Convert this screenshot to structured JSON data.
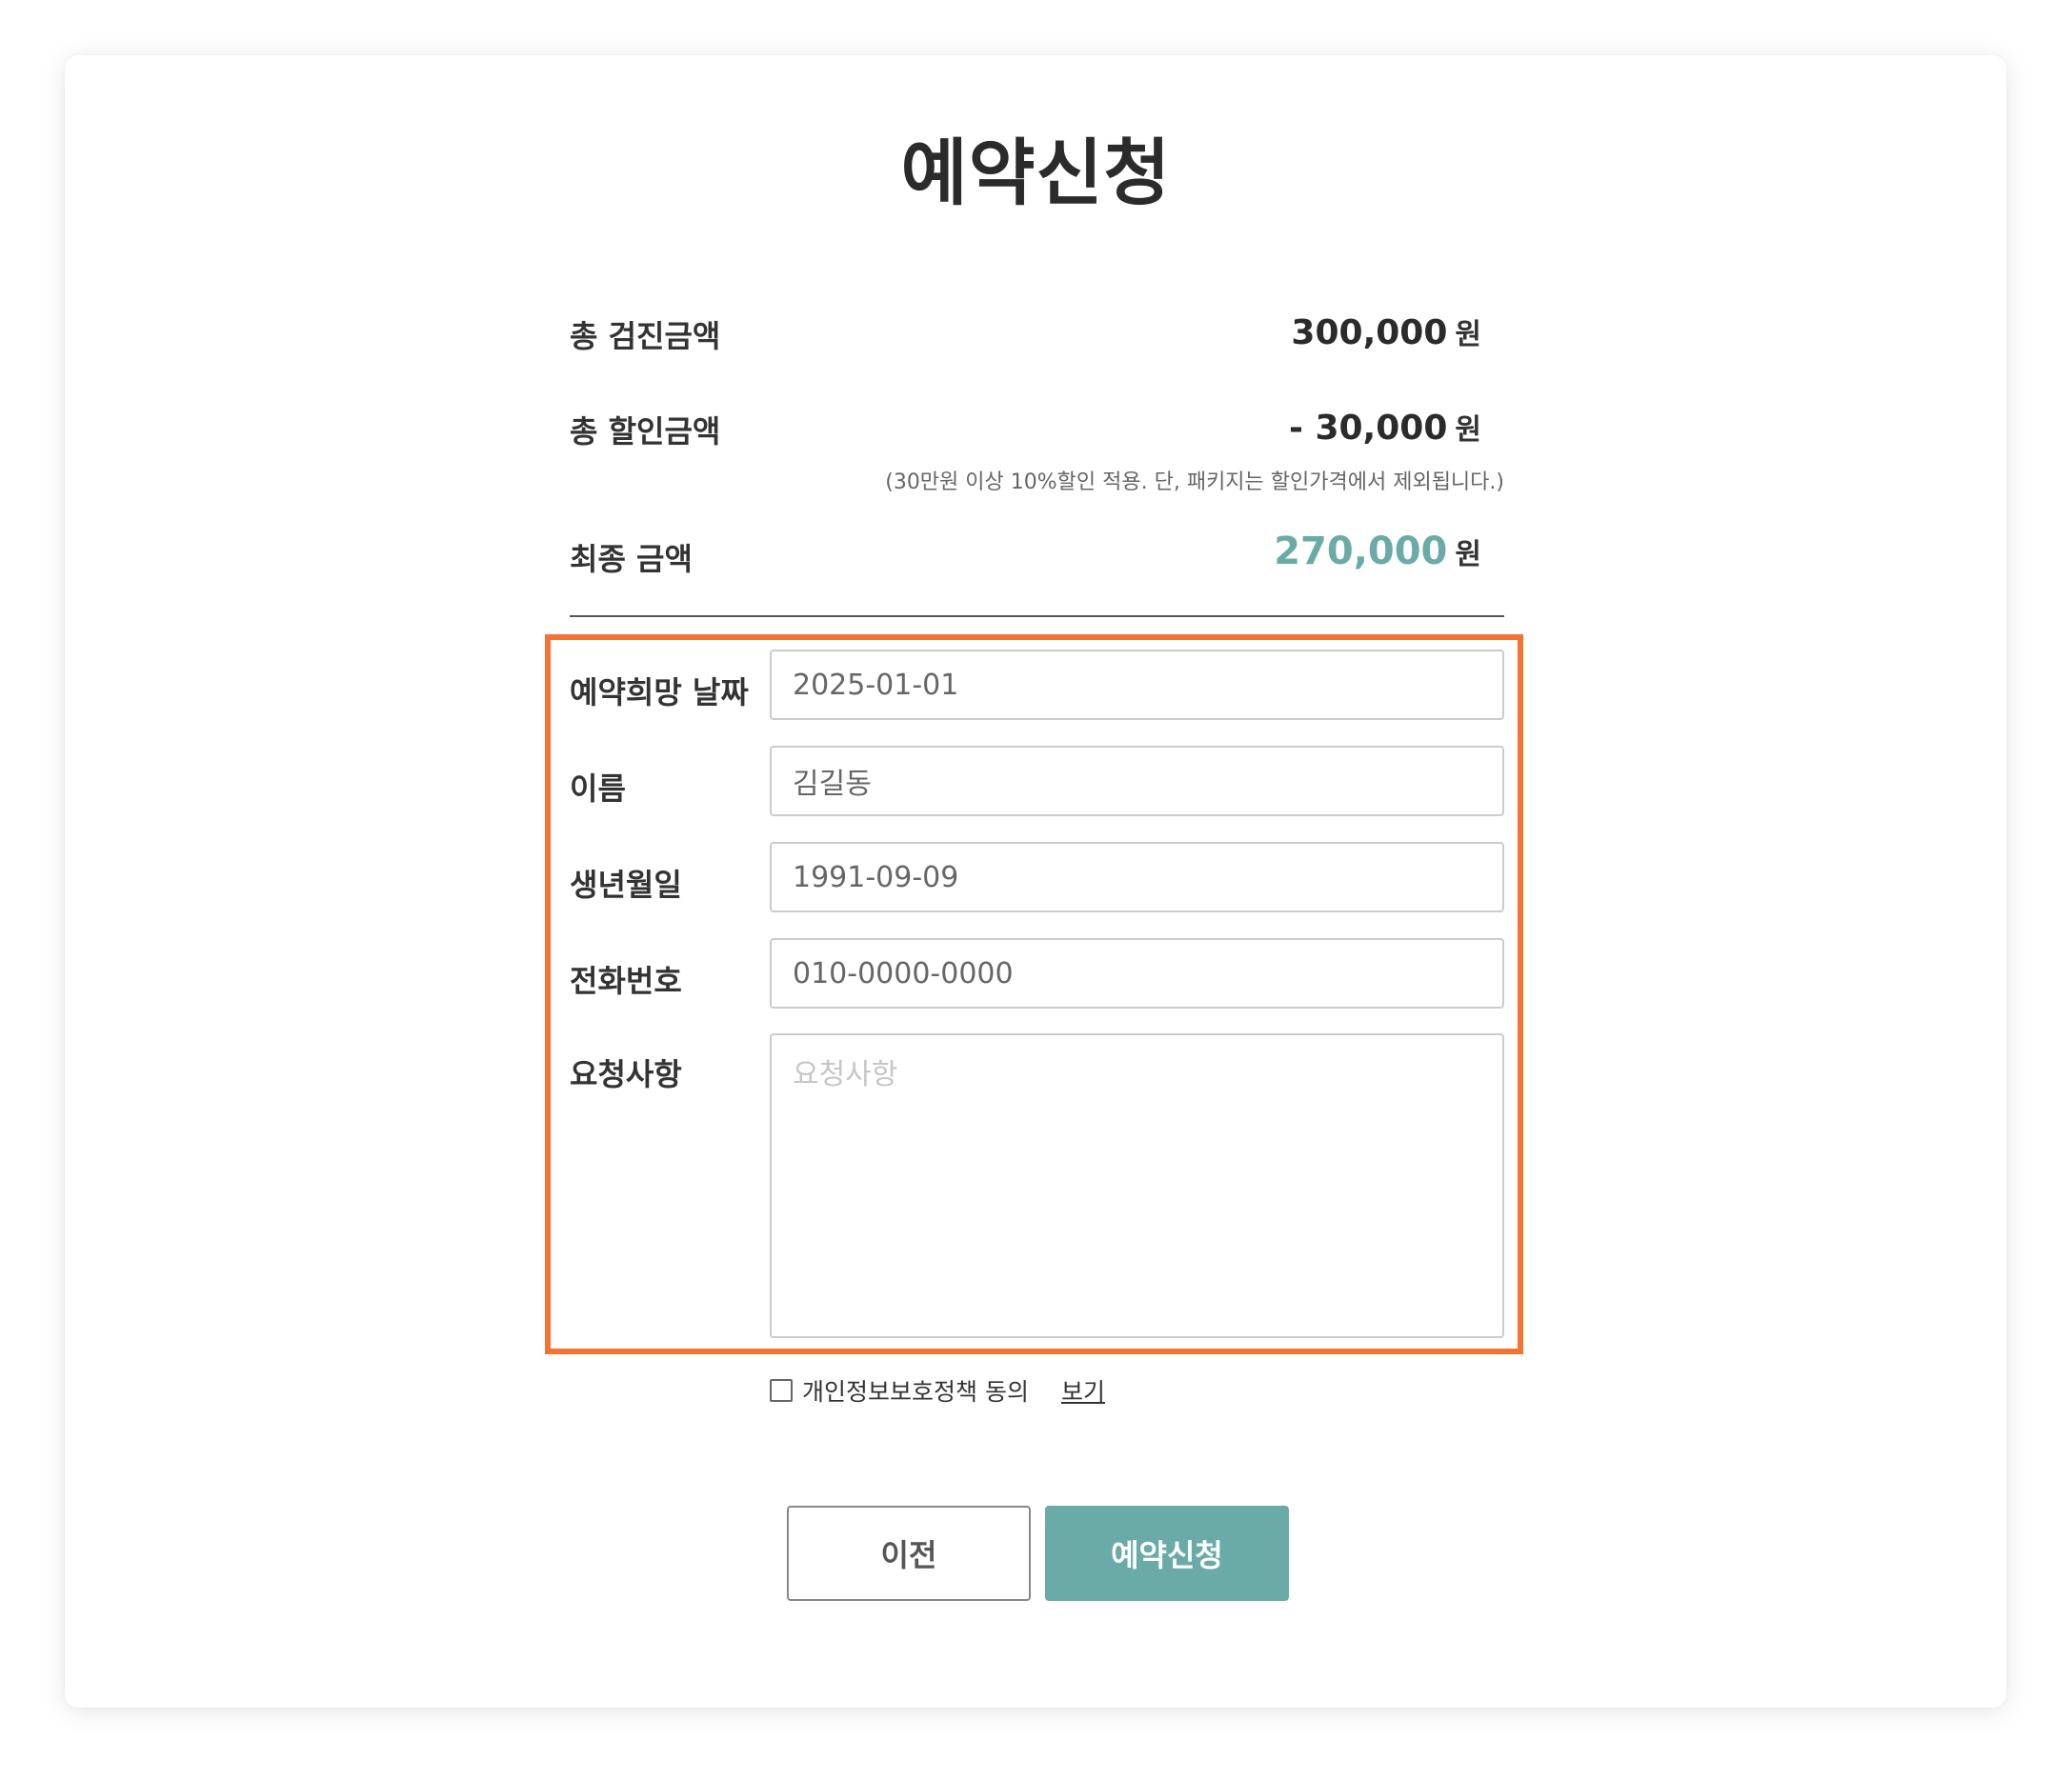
{
  "title": "예약신청",
  "summary": {
    "total_label": "총 검진금액",
    "total_amount": "300,000",
    "discount_label": "총 할인금액",
    "discount_amount": "- 30,000",
    "discount_note": "(30만원 이상 10%할인 적용. 단, 패키지는 할인가격에서 제외됩니다.)",
    "final_label": "최종 금액",
    "final_amount": "270,000",
    "unit": "원"
  },
  "form": {
    "date_label": "예약희망 날짜",
    "date_value": "2025-01-01",
    "name_label": "이름",
    "name_value": "김길동",
    "birth_label": "생년월일",
    "birth_value": "1991-09-09",
    "phone_label": "전화번호",
    "phone_value": "010-0000-0000",
    "request_label": "요청사항",
    "request_placeholder": "요청사항"
  },
  "agreement": {
    "label": "개인정보보호정책 동의",
    "link": "보기"
  },
  "buttons": {
    "prev": "이전",
    "submit": "예약신청"
  },
  "colors": {
    "accent": "#6aaba7",
    "highlight": "#f47232"
  }
}
